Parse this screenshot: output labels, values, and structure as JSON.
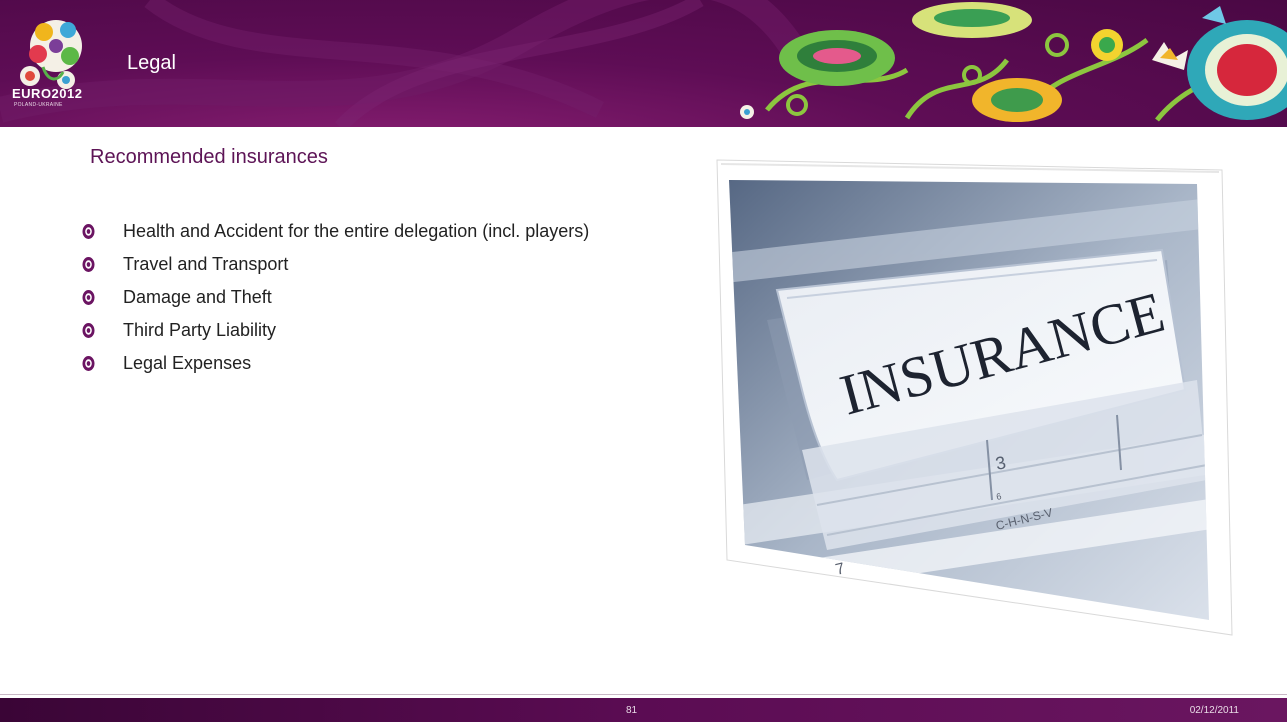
{
  "header": {
    "section_title": "Legal",
    "logo_text": "EURO2012",
    "logo_subtext": "POLAND-UKRAINE",
    "brand_color": "#5e0d55"
  },
  "main": {
    "subtitle": "Recommended insurances",
    "bullets": [
      {
        "text": "Health and Accident for the entire delegation (incl. players)"
      },
      {
        "text": "Travel and Transport"
      },
      {
        "text": "Damage and Theft"
      },
      {
        "text": "Third Party Liability"
      },
      {
        "text": "Legal Expenses"
      }
    ],
    "photo": {
      "label": "INSURANCE",
      "tab_number": "3",
      "letters": "C-H-N-S-V",
      "number_7": "7",
      "number_6": "6"
    }
  },
  "footer": {
    "page_number": "81",
    "date": "02/12/2011"
  }
}
